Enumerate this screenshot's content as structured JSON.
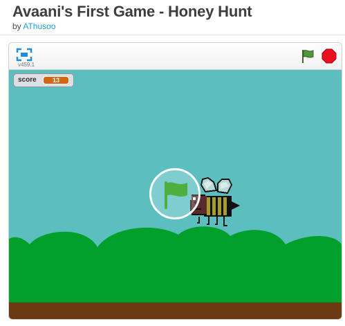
{
  "project": {
    "title": "Avaani's First Game - Honey Hunt",
    "by_label": "by",
    "author": "AThusoo"
  },
  "player": {
    "version": "v459.1",
    "fullscreen_icon": "fullscreen-icon",
    "green_flag_icon": "green-flag-icon",
    "stop_icon": "stop-sign-icon"
  },
  "stage": {
    "score_monitor": {
      "label": "score",
      "value": "13"
    },
    "sprites": [
      "bee"
    ],
    "overlay_icon": "green-flag-icon"
  },
  "colors": {
    "sky": "#5bbfc0",
    "hills": "#00a02a",
    "ground": "#6b3a14",
    "flag_green": "#4caf3f",
    "stop_red": "#e8111d",
    "score_value_bg": "#d56413",
    "author_link": "#1aa0d8"
  }
}
